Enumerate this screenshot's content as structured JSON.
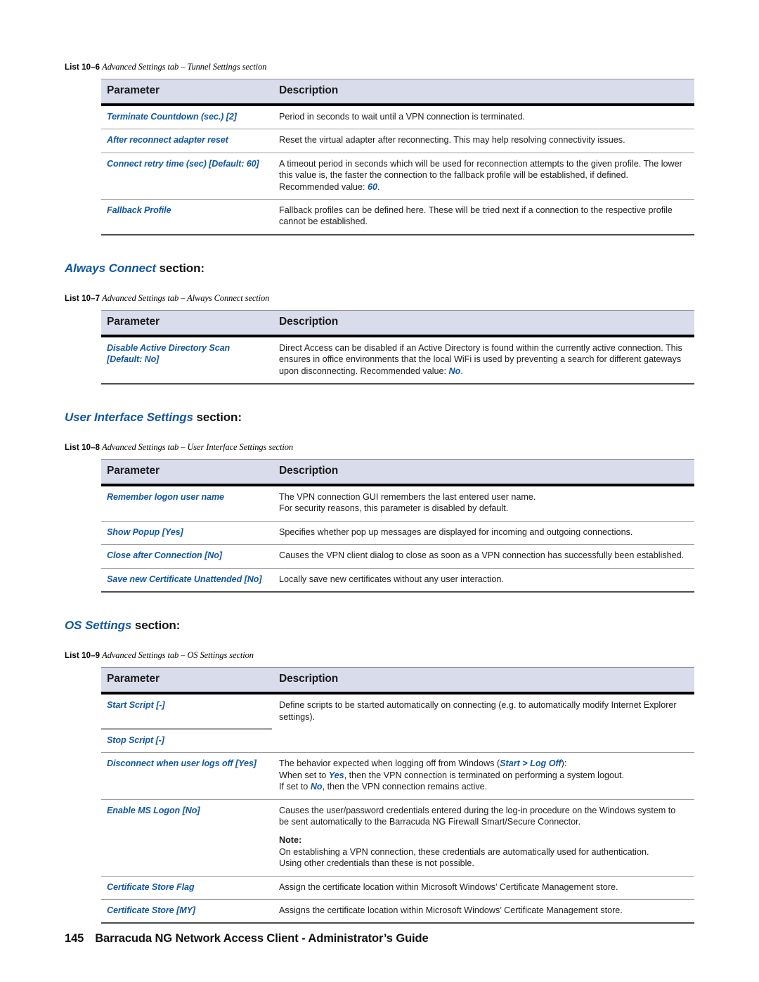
{
  "page": {
    "number": "145",
    "footer_title": "Barracuda NG Network Access Client - Administrator’s Guide"
  },
  "table_headers": {
    "parameter": "Parameter",
    "description": "Description"
  },
  "tables": [
    {
      "id": "tunnel-settings",
      "caption_number": "List 10–6",
      "caption_text": "Advanced Settings tab – Tunnel Settings section",
      "rows": [
        {
          "param": "Terminate Countdown (sec.)",
          "param_default": "[2]",
          "desc": "Period in seconds to wait until a VPN connection is terminated."
        },
        {
          "param": "After reconnect adapter reset",
          "param_default": "",
          "desc": "Reset the virtual adapter after reconnecting. This may help resolving connectivity issues."
        },
        {
          "param": "Connect retry time (sec) [Default: 60]",
          "param_default": "",
          "desc_pre": "A timeout period in seconds which will be used for reconnection attempts to the given profile. The lower this value is, the faster the connection to the fallback profile will be established, if defined. Recommended value: ",
          "desc_em": "60",
          "desc_post": "."
        },
        {
          "param": "Fallback Profile",
          "param_default": "",
          "desc": "Fallback profiles can be defined here. These will be tried next if a connection to the respective profile cannot be established."
        }
      ]
    },
    {
      "id": "always-connect",
      "section_name": "Always Connect",
      "section_suffix": " section:",
      "caption_number": "List 10–7",
      "caption_text": "Advanced Settings tab – Always Connect section",
      "rows": [
        {
          "param": "Disable Active Directory Scan",
          "param_default": "[Default: No]",
          "desc_pre": "Direct Access can be disabled if an Active Directory is found within the currently active connection. This ensures in office environments that the local WiFi is used by preventing a search for different gateways upon disconnecting. Recommended value: ",
          "desc_em": "No",
          "desc_post": "."
        }
      ]
    },
    {
      "id": "user-interface-settings",
      "section_name": "User Interface Settings",
      "section_suffix": " section:",
      "caption_number": "List 10–8",
      "caption_text": "Advanced Settings tab – User Interface Settings section",
      "rows": [
        {
          "param": "Remember logon user name",
          "param_default": "",
          "desc_line1": "The VPN connection GUI remembers the last entered user name.",
          "desc_line2": "For security reasons, this parameter is disabled by default."
        },
        {
          "param": "Show Popup",
          "param_default": "[Yes]",
          "desc": "Specifies whether pop up messages are displayed for incoming and outgoing connections."
        },
        {
          "param": "Close after Connection",
          "param_default": "[No]",
          "desc": "Causes the VPN client dialog to close as soon as a VPN connection has successfully been established."
        },
        {
          "param": "Save new Certificate Unattended",
          "param_default": "[No]",
          "desc": "Locally save new certificates without any user interaction."
        }
      ]
    },
    {
      "id": "os-settings",
      "section_name": "OS Settings",
      "section_suffix": " section:",
      "caption_number": "List 10–9",
      "caption_text": "Advanced Settings tab – OS Settings section",
      "rows": [
        {
          "param": "Start Script",
          "param_default": "[-]",
          "desc": "Define scripts to be started automatically on connecting (e.g. to automatically modify Internet Explorer settings)."
        },
        {
          "param": "Stop Script",
          "param_default": "[-]",
          "desc": ""
        },
        {
          "param": "Disconnect when user logs off",
          "param_default": "[Yes]",
          "desc_line1_pre": "The behavior expected when logging off from Windows (",
          "desc_line1_em": "Start > Log Off",
          "desc_line1_post": "):",
          "desc_line2_pre": "When set to ",
          "desc_line2_em": "Yes",
          "desc_line2_post": ", then the VPN connection is terminated on performing a system logout.",
          "desc_line3_pre": "If set to ",
          "desc_line3_em": "No",
          "desc_line3_post": ", then the VPN connection remains active."
        },
        {
          "param": "Enable MS Logon",
          "param_default": "[No]",
          "desc_line1": "Causes the user/password credentials entered during the log-in procedure on the Windows system to be sent automatically to the Barracuda NG Firewall Smart/Secure Connector.",
          "note_label": "Note:",
          "desc_line2": "On establishing a VPN connection, these credentials are automatically used for authentication.",
          "desc_line3": "Using other credentials than these is not possible."
        },
        {
          "param": "Certificate Store Flag",
          "param_default": "",
          "desc": "Assign the certificate location within Microsoft Windows’ Certificate Management store."
        },
        {
          "param": "Certificate Store",
          "param_default": "[MY]",
          "desc": "Assigns the certificate location within Microsoft Windows’ Certificate Management store."
        }
      ]
    }
  ]
}
